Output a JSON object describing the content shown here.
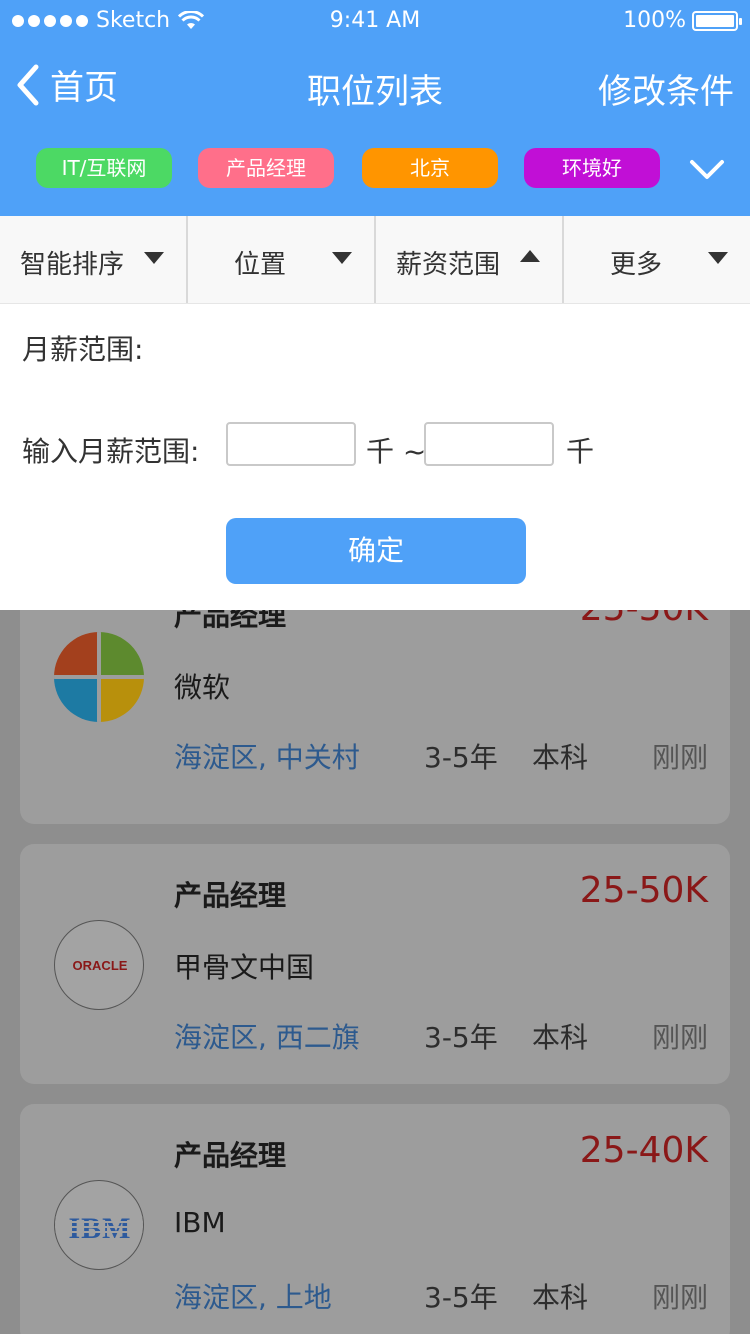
{
  "status": {
    "carrier": "Sketch",
    "time": "9:41 AM",
    "battery": "100%"
  },
  "nav": {
    "back_label": "首页",
    "title": "职位列表",
    "right_label": "修改条件"
  },
  "tags": [
    {
      "label": "IT/互联网",
      "color": "#4cd964"
    },
    {
      "label": "产品经理",
      "color": "#ff6f8a"
    },
    {
      "label": "北京",
      "color": "#ff9500"
    },
    {
      "label": "环境好",
      "color": "#c10fd6"
    }
  ],
  "filters": [
    {
      "label": "智能排序",
      "direction": "down"
    },
    {
      "label": "位置",
      "direction": "down"
    },
    {
      "label": "薪资范围",
      "direction": "up"
    },
    {
      "label": "更多",
      "direction": "down"
    }
  ],
  "panel": {
    "title": "月薪范围:",
    "range_label": "输入月薪范围:",
    "unit1": "千 ~",
    "unit2": "千",
    "confirm_label": "确定",
    "min_value": "",
    "max_value": ""
  },
  "jobs": [
    {
      "title": "产品经理",
      "salary": "25-50K",
      "company": "微软",
      "location": "海淀区, 中关村",
      "experience": "3-5年",
      "education": "本科",
      "posted": "刚刚",
      "logo": "microsoft-logo"
    },
    {
      "title": "产品经理",
      "salary": "25-50K",
      "company": "甲骨文中国",
      "location": "海淀区, 西二旗",
      "experience": "3-5年",
      "education": "本科",
      "posted": "刚刚",
      "logo": "oracle-logo",
      "logo_text": "ORACLE"
    },
    {
      "title": "产品经理",
      "salary": "25-40K",
      "company": "IBM",
      "location": "海淀区, 上地",
      "experience": "3-5年",
      "education": "本科",
      "posted": "刚刚",
      "logo": "ibm-logo",
      "logo_text": "IBM"
    }
  ]
}
